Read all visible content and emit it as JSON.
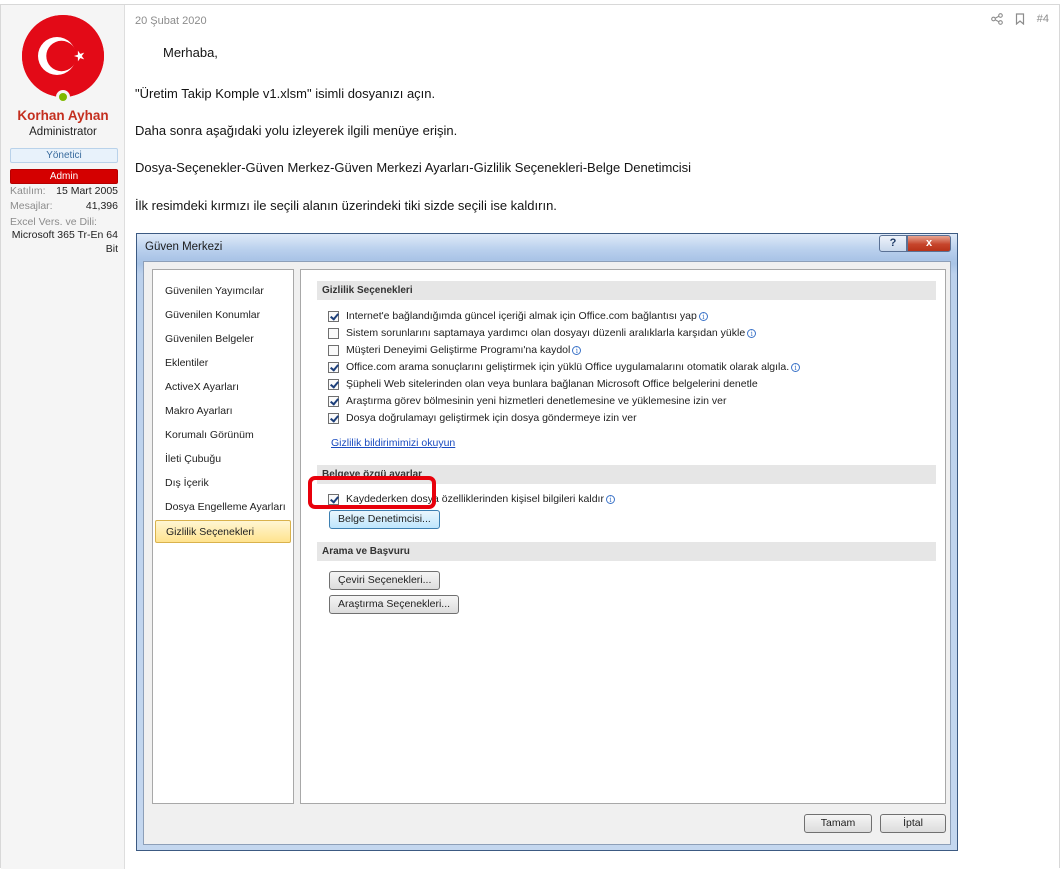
{
  "user": {
    "name": "Korhan Ayhan",
    "title": "Administrator",
    "banner_yonetici": "Yönetici",
    "banner_admin": "Admin",
    "katilim_label": "Katılım:",
    "katilim_value": "15 Mart 2005",
    "mesajlar_label": "Mesajlar:",
    "mesajlar_value": "41,396",
    "excel_label": "Excel Vers. ve Dili:",
    "excel_value": "Microsoft 365 Tr-En 64 Bit"
  },
  "post": {
    "date": "20 Şubat 2020",
    "number": "#4",
    "paragraphs": [
      "Merhaba,",
      "\"Üretim Takip Komple v1.xlsm\" isimli dosyanızı açın.",
      "Daha sonra aşağıdaki yolu izleyerek ilgili menüye erişin.",
      "Dosya-Seçenekler-Güven Merkez-Güven Merkezi Ayarları-Gizlilik Seçenekleri-Belge Denetimcisi",
      "İlk resimdeki kırmızı ile seçili alanın üzerindeki tiki sizde seçili ise kaldırın."
    ]
  },
  "dialog": {
    "title": "Güven Merkezi",
    "help_glyph": "?",
    "close_glyph": "x",
    "nav": [
      "Güvenilen Yayımcılar",
      "Güvenilen Konumlar",
      "Güvenilen Belgeler",
      "Eklentiler",
      "ActiveX Ayarları",
      "Makro Ayarları",
      "Korumalı Görünüm",
      "İleti Çubuğu",
      "Dış İçerik",
      "Dosya Engelleme Ayarları",
      "Gizlilik Seçenekleri"
    ],
    "privacy_header": "Gizlilik Seçenekleri",
    "options": [
      "Internet'e bağlandığımda güncel içeriği almak için Office.com bağlantısı yap",
      "Sistem sorunlarını saptamaya yardımcı olan dosyayı düzenli aralıklarla karşıdan yükle",
      "Müşteri Deneyimi Geliştirme Programı'na kaydol",
      "Office.com arama sonuçlarını geliştirmek için yüklü Office uygulamalarını otomatik olarak algıla.",
      "Şüpheli Web sitelerinden olan veya bunlara bağlanan Microsoft Office belgelerini denetle",
      "Araştırma görev bölmesinin yeni hizmetleri denetlemesine ve yüklemesine izin ver",
      "Dosya doğrulamayı geliştirmek için dosya göndermeye izin ver"
    ],
    "privacy_link": "Gizlilik bildirimimizi okuyun",
    "doc_header": "Belgeye özgü ayarlar",
    "doc_option": "Kaydederken dosya özelliklerinden kişisel bilgileri kaldır",
    "inspector_button": "Belge Denetimcisi...",
    "research_header": "Arama ve Başvuru",
    "translation_button": "Çeviri Seçenekleri...",
    "research_button": "Araştırma Seçenekleri...",
    "ok_button": "Tamam",
    "cancel_button": "İptal",
    "info_glyph": "i"
  }
}
